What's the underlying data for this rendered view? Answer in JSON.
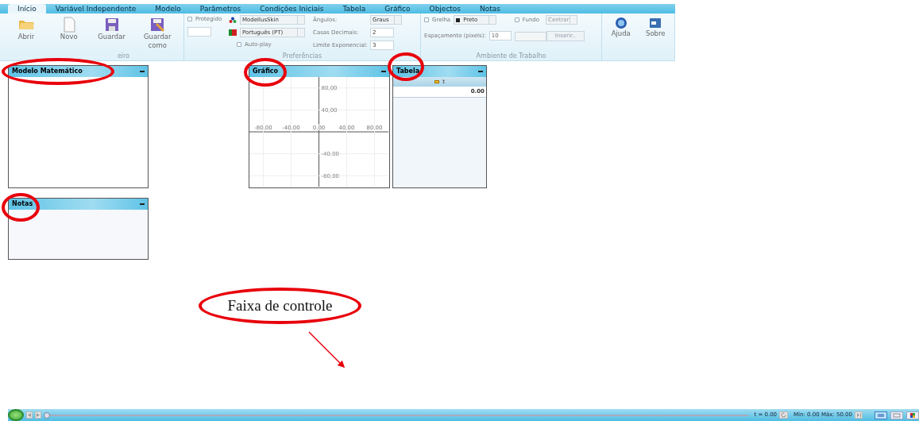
{
  "tabs": [
    {
      "label": "Início",
      "selected": true
    },
    {
      "label": "Variável Independente",
      "selected": false
    },
    {
      "label": "Modelo",
      "selected": false
    },
    {
      "label": "Parâmetros",
      "selected": false
    },
    {
      "label": "Condições Iniciais",
      "selected": false
    },
    {
      "label": "Tabela",
      "selected": false
    },
    {
      "label": "Gráfico",
      "selected": false
    },
    {
      "label": "Objectos",
      "selected": false
    },
    {
      "label": "Notas",
      "selected": false
    }
  ],
  "ribbon": {
    "file_group": {
      "label": "eiro",
      "buttons": [
        "Abrir",
        "Novo",
        "Guardar",
        "Guardar como"
      ]
    },
    "preferences": {
      "label": "Preferências",
      "protected": {
        "label": "Protegido",
        "checked": false
      },
      "skin": "ModellusSkin",
      "language": "Português (PT)",
      "autoplay": {
        "label": "Auto-play",
        "checked": false
      },
      "angles": {
        "label": "Ângulos:",
        "value": "Graus"
      },
      "decimals": {
        "label": "Casas Decimais:",
        "value": "2"
      },
      "exp_limit": {
        "label": "Limite Exponencial:",
        "value": "3"
      }
    },
    "workspace": {
      "label": "Ambiente de Trabalho",
      "grid": {
        "label": "Grelha",
        "checked": false
      },
      "grid_color": "Preto",
      "background": {
        "label": "Fundo",
        "checked": false
      },
      "position": "Centrar",
      "spacing": {
        "label": "Espaçamento (pixels):",
        "value": "10"
      },
      "insert_button": "Inserir.."
    },
    "help_group": {
      "buttons": [
        "Ajuda",
        "Sobre"
      ]
    }
  },
  "panels": [
    {
      "title": "Modelo Matemático",
      "kind": "model",
      "circled": true
    },
    {
      "title": "Gráfico",
      "kind": "graph",
      "circled": true,
      "chart_data": {
        "type": "line",
        "grid": true,
        "xlim": [
          -100,
          100
        ],
        "ylim": [
          -100,
          100
        ],
        "xticks": [
          {
            "value": -80,
            "label": "-80,00"
          },
          {
            "value": -40,
            "label": "-40,00"
          },
          {
            "value": 0,
            "label": "0,00"
          },
          {
            "value": 40,
            "label": "40,00"
          },
          {
            "value": 80,
            "label": "80,00"
          }
        ],
        "yticks": [
          {
            "value": 80,
            "label": "80,00"
          },
          {
            "value": 40,
            "label": "40,00"
          },
          {
            "value": -40,
            "label": "-40,00"
          },
          {
            "value": -80,
            "label": "-80,00"
          }
        ]
      }
    },
    {
      "title": "Tabela",
      "kind": "table",
      "circled": true,
      "column": "t",
      "cell": "0.00"
    },
    {
      "title": "Notas",
      "kind": "notes",
      "circled": true
    }
  ],
  "annotation": {
    "label": "Faixa de controle"
  },
  "control_bar": {
    "slider": {
      "level": 0
    },
    "time": "t = 0.00",
    "range": "Mín: 0.00 Máx: 50.00",
    "views": [
      {
        "selected": true
      },
      {
        "selected": false
      },
      {
        "selected": false
      }
    ]
  }
}
